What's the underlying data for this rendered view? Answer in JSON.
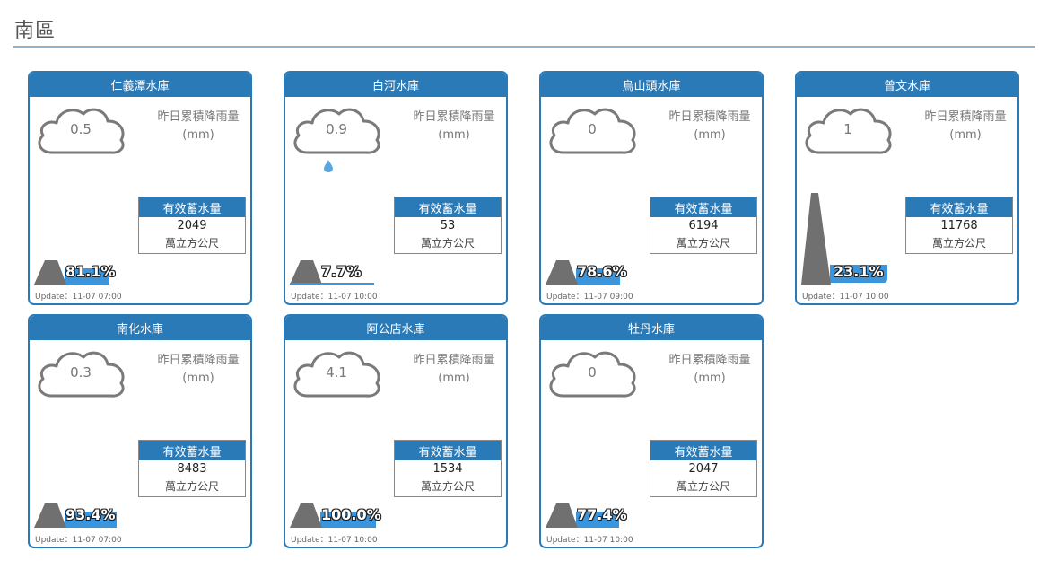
{
  "region": {
    "title": "南區"
  },
  "labels": {
    "rain_line1": "昨日累積降雨量",
    "rain_line2": "(mm)",
    "storage_title": "有效蓄水量",
    "storage_unit": "萬立方公尺"
  },
  "colors": {
    "accent": "#2a7ab8",
    "water": "#3b95dd",
    "dam": "#707070"
  },
  "reservoirs": [
    {
      "name": "仁義潭水庫",
      "rain": "0.5",
      "storage": "2049",
      "percent": "81.1%",
      "fill": 0.811,
      "update": "Update：11-07 07:00",
      "raindrop": false
    },
    {
      "name": "白河水庫",
      "rain": "0.9",
      "storage": "53",
      "percent": "7.7%",
      "fill": 0.077,
      "update": "Update：11-07 10:00",
      "raindrop": true
    },
    {
      "name": "烏山頭水庫",
      "rain": "0",
      "storage": "6194",
      "percent": "78.6%",
      "fill": 0.786,
      "update": "Update：11-07 09:00",
      "raindrop": false
    },
    {
      "name": "曾文水庫",
      "rain": "1",
      "storage": "11768",
      "percent": "23.1%",
      "fill": 0.231,
      "update": "Update：11-07 10:00",
      "raindrop": false
    },
    {
      "name": "南化水庫",
      "rain": "0.3",
      "storage": "8483",
      "percent": "93.4%",
      "fill": 0.934,
      "update": "Update：11-07 07:00",
      "raindrop": false
    },
    {
      "name": "阿公店水庫",
      "rain": "4.1",
      "storage": "1534",
      "percent": "100.0%",
      "fill": 1.0,
      "update": "Update：11-07 10:00",
      "raindrop": false
    },
    {
      "name": "牡丹水庫",
      "rain": "0",
      "storage": "2047",
      "percent": "77.4%",
      "fill": 0.774,
      "update": "Update：11-07 10:00",
      "raindrop": false
    }
  ]
}
